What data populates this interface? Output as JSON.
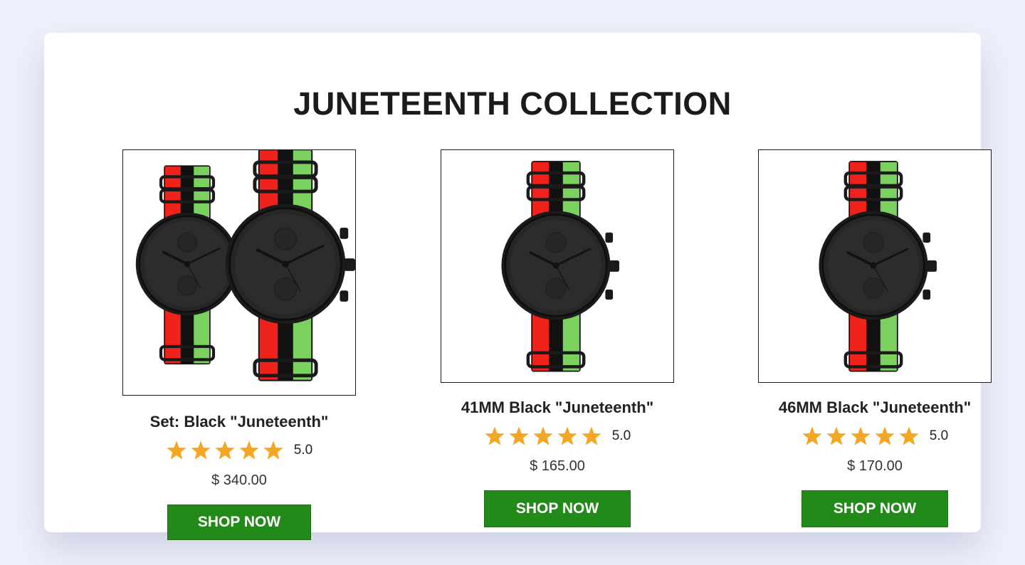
{
  "collection": {
    "title": "JUNETEENTH COLLECTION"
  },
  "products": [
    {
      "name": "Set: Black \"Juneteenth\"",
      "rating": "5.0",
      "stars": 5,
      "price": "$ 340.00",
      "button_label": "SHOP NOW",
      "image": "watch-set-icon"
    },
    {
      "name": "41MM Black \"Juneteenth\"",
      "rating": "5.0",
      "stars": 5,
      "price": "$ 165.00",
      "button_label": "SHOP NOW",
      "image": "watch-icon"
    },
    {
      "name": "46MM Black \"Juneteenth\"",
      "rating": "5.0",
      "stars": 5,
      "price": "$ 170.00",
      "button_label": "SHOP NOW",
      "image": "watch-icon"
    }
  ],
  "colors": {
    "button": "#228a18",
    "star": "#f5a623",
    "strap_red": "#f0231c",
    "strap_black": "#111111",
    "strap_green": "#7bd160",
    "watch_case": "#1e1e1e"
  }
}
